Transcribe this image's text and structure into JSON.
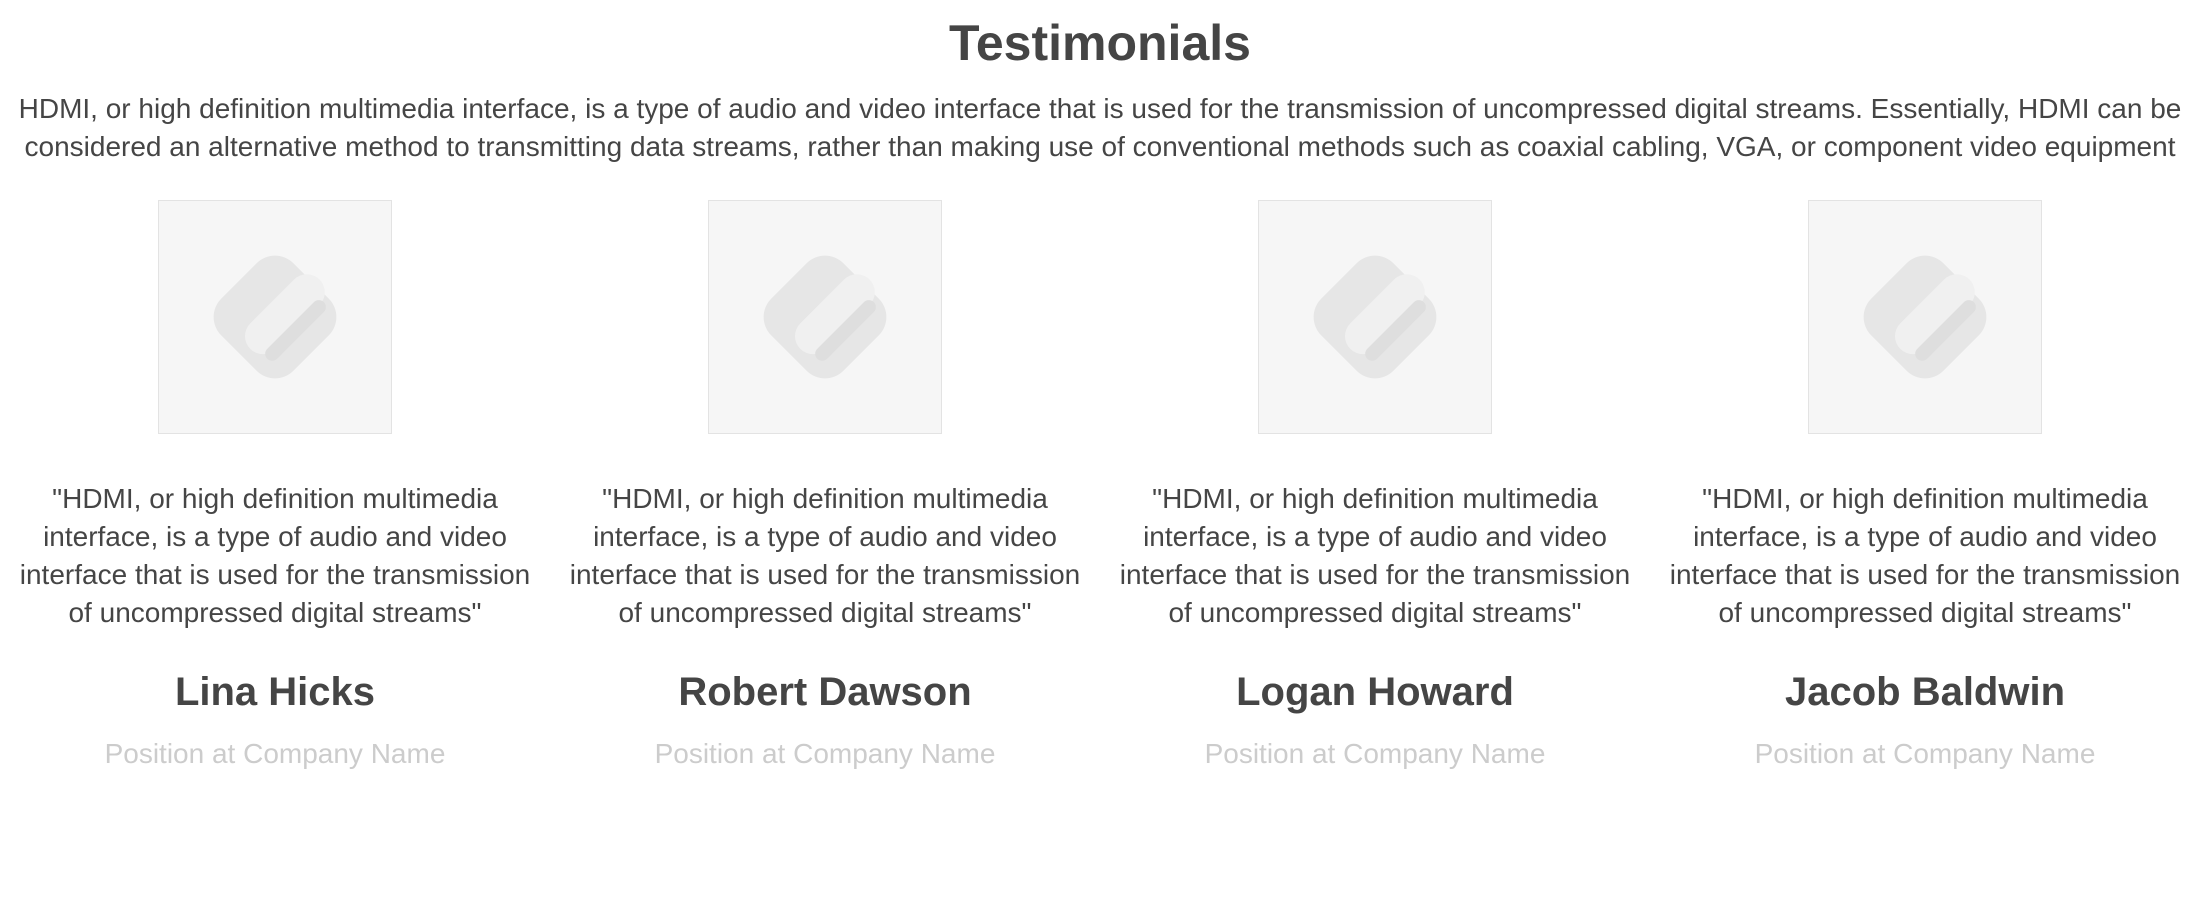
{
  "section": {
    "title": "Testimonials",
    "intro": "HDMI, or high definition multimedia interface, is a type of audio and video interface that is used for the transmission of uncompressed digital streams. Essentially, HDMI can be considered an alternative method to transmitting data streams, rather than making use of conventional methods such as coaxial cabling, VGA, or component video equipment"
  },
  "avatar_icon": "image-placeholder-icon",
  "colors": {
    "text": "#454545",
    "muted": "#cccccc",
    "avatar_bg": "#f6f6f6",
    "avatar_border": "#e3e3e3",
    "placeholder_shape": "#e6e6e6"
  },
  "testimonials": [
    {
      "quote": "\"HDMI, or high definition multimedia interface, is a type of audio and video interface that is used for the transmission of uncompressed digital streams\"",
      "name": "Lina Hicks",
      "position": "Position at Company Name"
    },
    {
      "quote": "\"HDMI, or high definition multimedia interface, is a type of audio and video interface that is used for the transmission of uncompressed digital streams\"",
      "name": "Robert Dawson",
      "position": "Position at Company Name"
    },
    {
      "quote": "\"HDMI, or high definition multimedia interface, is a type of audio and video interface that is used for the transmission of uncompressed digital streams\"",
      "name": "Logan Howard",
      "position": "Position at Company Name"
    },
    {
      "quote": "\"HDMI, or high definition multimedia interface, is a type of audio and video interface that is used for the transmission of uncompressed digital streams\"",
      "name": "Jacob Baldwin",
      "position": "Position at Company Name"
    }
  ]
}
